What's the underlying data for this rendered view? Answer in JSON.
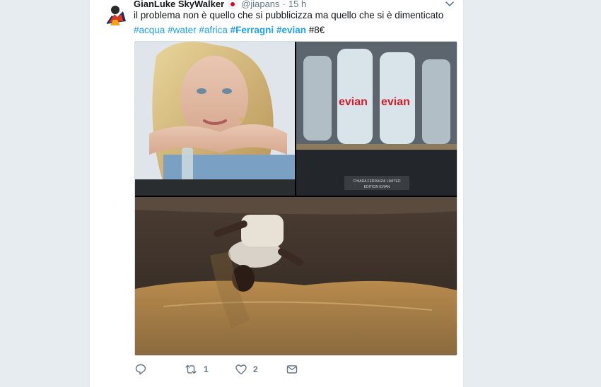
{
  "tweet": {
    "author_name": "GianLuke SkyWalker",
    "handle": "@jiapans",
    "separator": "·",
    "time": "15 h",
    "text_plain": "il problema non è quello che si pubblicizza ma quello che si è dimenticato",
    "hashtags": [
      "#acqua",
      "#water",
      "#africa",
      "#Ferragni",
      "#evian"
    ],
    "trailing_text": "#8€",
    "media": {
      "bottle_word": "evian",
      "caption_line1": "CHIARA FERRAGNI LIMITED",
      "caption_line2": "EDITION EVIAN"
    }
  },
  "actions": {
    "reply_count": "",
    "retweet_count": "1",
    "like_count": "2"
  },
  "colors": {
    "accent": "#1da1f2",
    "text": "#14171a",
    "muted": "#657786",
    "background": "#e6ecf0"
  },
  "icons": [
    "reply-icon",
    "retweet-icon",
    "like-icon",
    "message-icon",
    "chevron-down-icon",
    "flag-icon"
  ]
}
